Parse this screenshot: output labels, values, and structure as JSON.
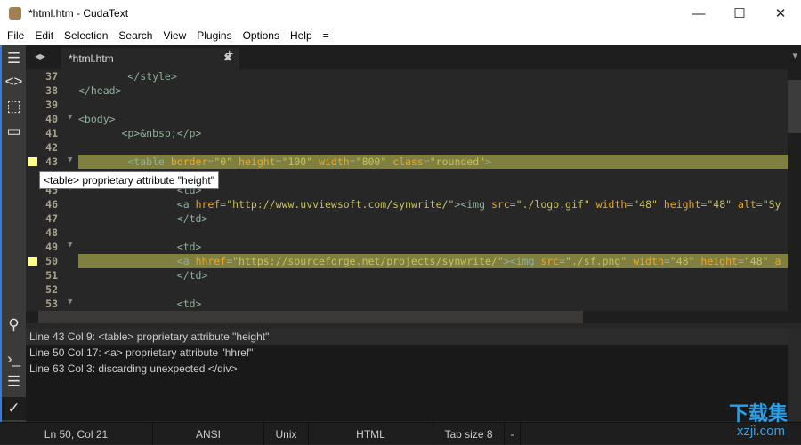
{
  "window": {
    "title": "*html.htm - CudaText",
    "minimize": "—",
    "maximize": "☐",
    "close": "✕"
  },
  "menu": [
    "File",
    "Edit",
    "Selection",
    "Search",
    "View",
    "Plugins",
    "Options",
    "Help",
    "="
  ],
  "tabs": [
    {
      "label": "*html.htm",
      "close": "✖"
    }
  ],
  "tabbar": {
    "arrows": "◂▸",
    "add": "+",
    "dropdown": "▾"
  },
  "editor": {
    "lines": [
      {
        "n": "37",
        "fold": "",
        "marker": false,
        "tokens": [
          [
            "t",
            "        </style>"
          ]
        ]
      },
      {
        "n": "38",
        "fold": "",
        "marker": false,
        "tokens": [
          [
            "t",
            "</head>"
          ]
        ]
      },
      {
        "n": "39",
        "fold": "",
        "marker": false,
        "tokens": []
      },
      {
        "n": "40",
        "fold": "▼",
        "marker": false,
        "tokens": [
          [
            "t",
            "<body>"
          ]
        ]
      },
      {
        "n": "41",
        "fold": "",
        "marker": false,
        "tokens": [
          [
            "t",
            "       <p>&nbsp;</p>"
          ]
        ]
      },
      {
        "n": "42",
        "fold": "",
        "marker": false,
        "tokens": []
      },
      {
        "n": "43",
        "fold": "▼",
        "marker": true,
        "hl": true,
        "tokens": [
          [
            "t",
            "        <table "
          ],
          [
            "a",
            "border"
          ],
          [
            "p",
            "="
          ],
          [
            "s",
            "\"0\" "
          ],
          [
            "a",
            "height"
          ],
          [
            "p",
            "="
          ],
          [
            "s",
            "\"100\" "
          ],
          [
            "a",
            "width"
          ],
          [
            "p",
            "="
          ],
          [
            "s",
            "\"800\" "
          ],
          [
            "a",
            "class"
          ],
          [
            "p",
            "="
          ],
          [
            "s",
            "\"rounded\""
          ],
          [
            "t",
            ">"
          ]
        ]
      },
      {
        "n": "44",
        "fold": "",
        "marker": false,
        "tokens": []
      },
      {
        "n": "45",
        "fold": "▼",
        "marker": false,
        "tokens": [
          [
            "t",
            "                <td>"
          ]
        ]
      },
      {
        "n": "46",
        "fold": "",
        "marker": false,
        "tokens": [
          [
            "t",
            "                <a "
          ],
          [
            "a",
            "href"
          ],
          [
            "p",
            "="
          ],
          [
            "s",
            "\"http://www.uvviewsoft.com/synwrite/\""
          ],
          [
            "t",
            "><img "
          ],
          [
            "a",
            "src"
          ],
          [
            "p",
            "="
          ],
          [
            "s",
            "\"./logo.gif\" "
          ],
          [
            "a",
            "width"
          ],
          [
            "p",
            "="
          ],
          [
            "s",
            "\"48\" "
          ],
          [
            "a",
            "height"
          ],
          [
            "p",
            "="
          ],
          [
            "s",
            "\"48\" "
          ],
          [
            "a",
            "alt"
          ],
          [
            "p",
            "="
          ],
          [
            "s",
            "\"Sy"
          ]
        ]
      },
      {
        "n": "47",
        "fold": "",
        "marker": false,
        "tokens": [
          [
            "t",
            "                </td>"
          ]
        ]
      },
      {
        "n": "48",
        "fold": "",
        "marker": false,
        "tokens": []
      },
      {
        "n": "49",
        "fold": "▼",
        "marker": false,
        "tokens": [
          [
            "t",
            "                <td>"
          ]
        ]
      },
      {
        "n": "50",
        "fold": "",
        "marker": true,
        "hl": true,
        "tokens": [
          [
            "t",
            "                <a "
          ],
          [
            "a",
            "hhref"
          ],
          [
            "p",
            "="
          ],
          [
            "s",
            "\"https://sourceforge.net/projects/synwrite/\""
          ],
          [
            "t",
            "><img "
          ],
          [
            "a",
            "src"
          ],
          [
            "p",
            "="
          ],
          [
            "s",
            "\"./sf.png\" "
          ],
          [
            "a",
            "width"
          ],
          [
            "p",
            "="
          ],
          [
            "s",
            "\"48\" "
          ],
          [
            "a",
            "height"
          ],
          [
            "p",
            "="
          ],
          [
            "s",
            "\"48\" "
          ],
          [
            "a",
            "a"
          ]
        ]
      },
      {
        "n": "51",
        "fold": "",
        "marker": false,
        "tokens": [
          [
            "t",
            "                </td>"
          ]
        ]
      },
      {
        "n": "52",
        "fold": "",
        "marker": false,
        "tokens": []
      },
      {
        "n": "53",
        "fold": "▼",
        "marker": false,
        "tokens": [
          [
            "t",
            "                <td>"
          ]
        ]
      }
    ]
  },
  "tooltip": "<table> proprietary attribute \"height\"",
  "output": [
    "Line 43 Col 9: <table> proprietary attribute \"height\"",
    "Line 50 Col 17: <a> proprietary attribute \"hhref\"",
    "Line 63 Col 3: discarding unexpected </div>"
  ],
  "statusbar": {
    "position": "Ln 50, Col 21",
    "encoding": "ANSI",
    "line_ending": "Unix",
    "lexer": "HTML",
    "tab_size": "Tab size 8",
    "extra": "-"
  },
  "watermark": {
    "cn": "下载集",
    "url": "xzji.com"
  }
}
